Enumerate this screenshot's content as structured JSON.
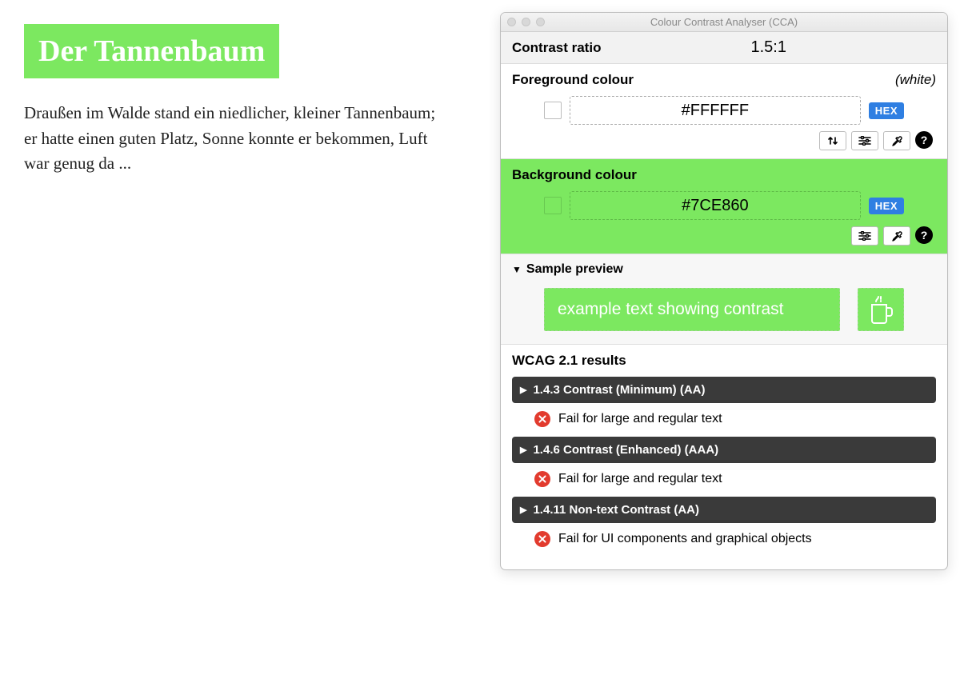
{
  "page": {
    "heading": "Der Tannenbaum",
    "paragraph": "Draußen im Walde stand ein niedlicher, kleiner Tannenbaum; er hatte einen guten Platz, Sonne konnte er bekommen, Luft war genug da ..."
  },
  "window": {
    "title": "Colour Contrast Analyser (CCA)"
  },
  "ratio": {
    "label": "Contrast ratio",
    "value": "1.5:1"
  },
  "foreground": {
    "label": "Foreground colour",
    "note": "(white)",
    "hex": "#FFFFFF",
    "swatch": "#FFFFFF",
    "format_button": "HEX"
  },
  "background": {
    "label": "Background colour",
    "hex": "#7CE860",
    "swatch": "#7CE860",
    "format_button": "HEX"
  },
  "preview": {
    "header": "Sample preview",
    "sample_text": "example text showing contrast"
  },
  "results": {
    "header": "WCAG 2.1 results",
    "items": [
      {
        "title": "1.4.3 Contrast (Minimum) (AA)",
        "msg": "Fail for large and regular text"
      },
      {
        "title": "1.4.6 Contrast (Enhanced) (AAA)",
        "msg": "Fail for large and regular text"
      },
      {
        "title": "1.4.11 Non-text Contrast (AA)",
        "msg": "Fail for UI components and graphical objects"
      }
    ]
  },
  "icons": {
    "swap": "↑↓",
    "sliders": "☰",
    "eyedropper": "✎",
    "help": "?"
  }
}
